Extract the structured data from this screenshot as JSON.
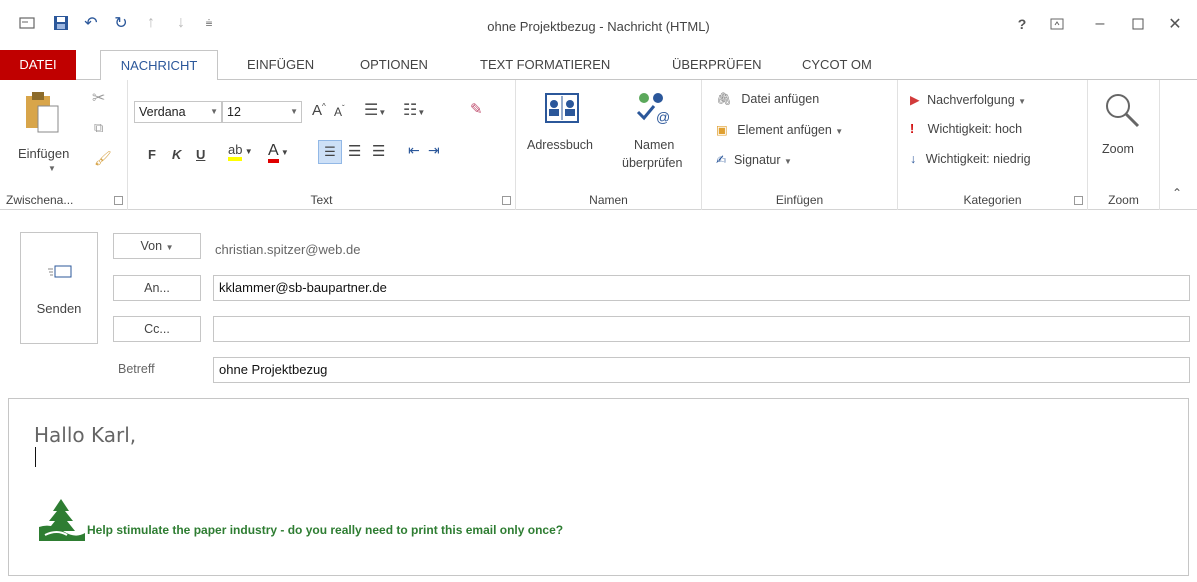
{
  "window": {
    "title": "ohne Projektbezug - Nachricht (HTML)",
    "help": "?"
  },
  "tabs": [
    "DATEI",
    "NACHRICHT",
    "EINFÜGEN",
    "OPTIONEN",
    "TEXT FORMATIEREN",
    "ÜBERPRÜFEN",
    "CYCOT OM"
  ],
  "ribbon": {
    "clipboard": {
      "paste": "Einfügen",
      "label": "Zwischena..."
    },
    "text": {
      "font": "Verdana",
      "size": "12",
      "bold": "F",
      "italic": "K",
      "underline": "U",
      "label": "Text"
    },
    "names": {
      "addressbook": "Adressbuch",
      "check_names_1": "Namen",
      "check_names_2": "überprüfen",
      "label": "Namen"
    },
    "insert": {
      "attach_file": "Datei anfügen",
      "attach_item": "Element anfügen",
      "signature": "Signatur",
      "label": "Einfügen"
    },
    "tags": {
      "followup": "Nachverfolgung",
      "high": "Wichtigkeit: hoch",
      "low": "Wichtigkeit: niedrig",
      "label": "Kategorien"
    },
    "zoom": {
      "button": "Zoom",
      "label": "Zoom"
    }
  },
  "header": {
    "send": "Senden",
    "from_button": "Von",
    "from_value": "christian.spitzer@web.de",
    "to_button": "An...",
    "to_value": "kklammer@sb-baupartner.de",
    "cc_button": "Cc...",
    "cc_value": "",
    "subject_label": "Betreff",
    "subject_value": "ohne Projektbezug"
  },
  "message": {
    "greeting": "Hallo Karl,",
    "footer": "Help stimulate the paper industry - do you really need to print this email only once?"
  },
  "colors": {
    "accent": "#2b579a",
    "file_tab": "#c00000",
    "footer_green": "#2e7d32"
  }
}
